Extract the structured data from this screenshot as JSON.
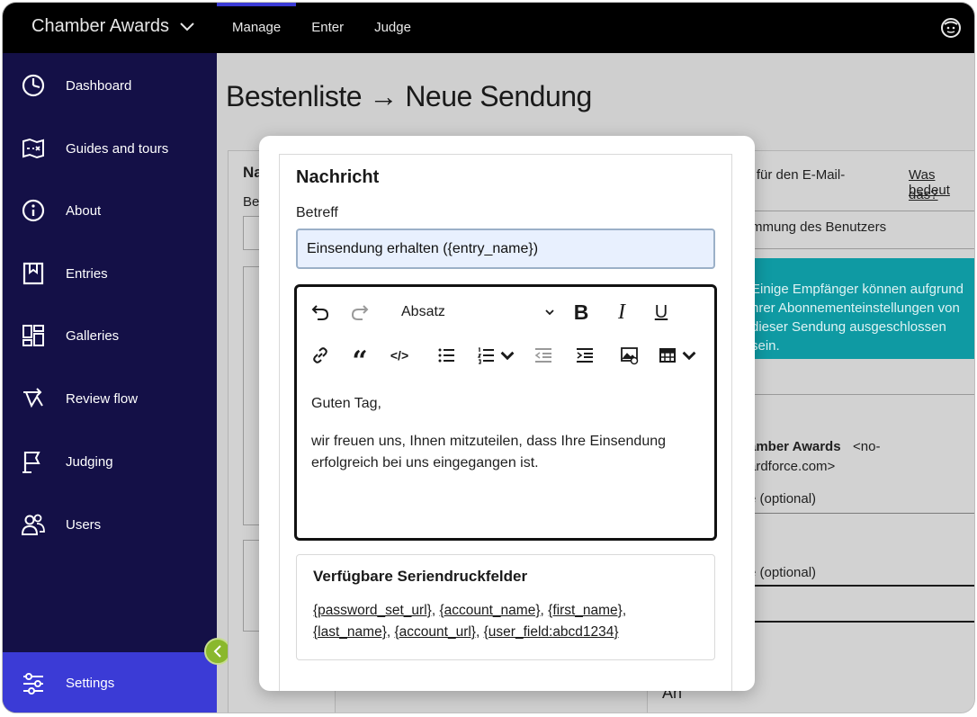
{
  "topbar": {
    "brand": "Chamber Awards",
    "nav": [
      "Manage",
      "Enter",
      "Judge"
    ]
  },
  "sidebar": {
    "items": [
      {
        "label": "Dashboard",
        "icon": "dashboard-icon"
      },
      {
        "label": "Guides and tours",
        "icon": "map-icon"
      },
      {
        "label": "About",
        "icon": "info-icon"
      },
      {
        "label": "Entries",
        "icon": "bookmark-icon"
      },
      {
        "label": "Galleries",
        "icon": "gallery-icon"
      },
      {
        "label": "Review flow",
        "icon": "review-flow-icon"
      },
      {
        "label": "Judging",
        "icon": "flag-icon"
      },
      {
        "label": "Users",
        "icon": "users-icon"
      }
    ],
    "settings": "Settings"
  },
  "page": {
    "title": "Bestenliste → Neue Sendung",
    "left_partial_heading": "Na",
    "left_partial_label": "Be",
    "right_text_1": "ge für den E-Mail-",
    "right_link": "Was bedeut",
    "right_link_2": "das?",
    "right_text_2": "stimmung des Benutzers",
    "teal_line_1": "Einige Empfänger können aufgrund",
    "teal_line_2": "hrer Abonnementeinstellungen von",
    "teal_line_3": "dieser Sendung ausgeschlossen sein.",
    "sender_bold": "amber Awards",
    "sender_rest": " <no-",
    "sender_line2": "ardforce.com>",
    "optional_1": "e (optional)",
    "optional_2": "e (optional)",
    "bottom_partial": "An"
  },
  "modal": {
    "title": "Nachricht",
    "subject_label": "Betreff",
    "subject_value": "Einsendung erhalten ({entry_name})",
    "format_select": "Absatz",
    "body_p1": "Guten Tag,",
    "body_p2": "wir freuen uns, Ihnen mitzuteilen, dass Ihre Einsendung erfolgreich bei uns eingegangen ist.",
    "merge_title": "Verfügbare Seriendruckfelder",
    "merge_fields": [
      "{password_set_url}",
      "{account_name}",
      "{first_name}",
      "{last_name}",
      "{account_url}",
      "{user_field:abcd1234}"
    ]
  },
  "colors": {
    "topbar": "#000000",
    "sidebar": "#141047",
    "settings_active": "#3b3bd6",
    "teal": "#0f9aa3",
    "collapse_button": "#8ab82d"
  }
}
